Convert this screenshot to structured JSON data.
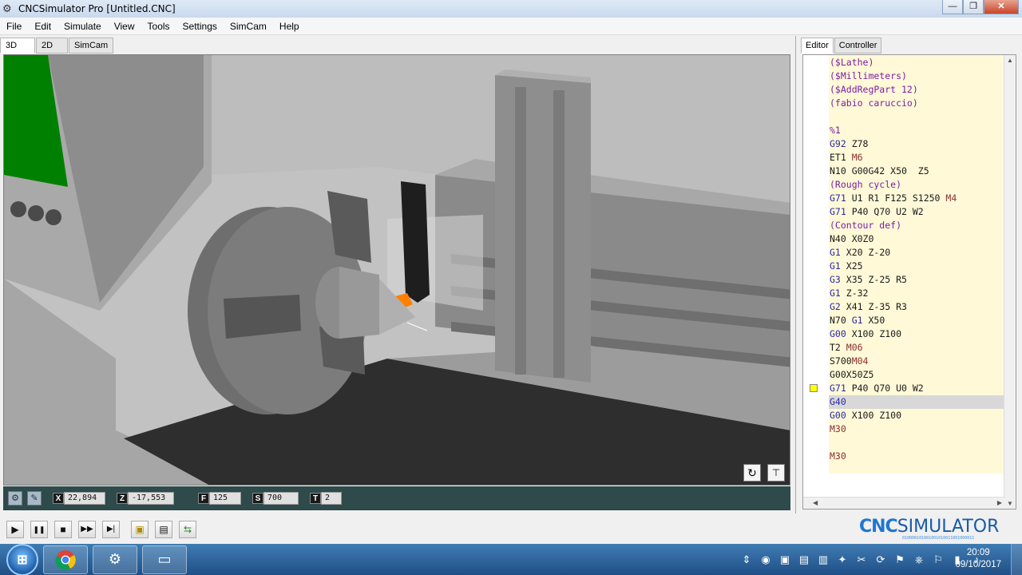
{
  "window": {
    "title": "CNCSimulator Pro [Untitled.CNC]",
    "min": "—",
    "max": "❐",
    "close": "✕"
  },
  "menu": [
    "File",
    "Edit",
    "Simulate",
    "View",
    "Tools",
    "Settings",
    "SimCam",
    "Help"
  ],
  "view_tabs": [
    "3D",
    "2D",
    "SimCam"
  ],
  "status": {
    "x_label": "X",
    "x_value": "22,894",
    "z_label": "Z",
    "z_value": "-17,553",
    "f_label": "F",
    "f_value": "125",
    "s_label": "S",
    "s_value": "700",
    "t_label": "T",
    "t_value": "2"
  },
  "editor_tabs": [
    "Editor",
    "Controller"
  ],
  "code_lines": [
    [
      {
        "t": "($Lathe)",
        "c": "purple"
      }
    ],
    [
      {
        "t": "($Millimeters)",
        "c": "purple"
      }
    ],
    [
      {
        "t": "($AddRegPart 12)",
        "c": "purple"
      }
    ],
    [
      {
        "t": "(fabio caruccio)",
        "c": "purple"
      }
    ],
    [
      {
        "t": "",
        "c": "black"
      }
    ],
    [
      {
        "t": "%1",
        "c": "purple"
      }
    ],
    [
      {
        "t": "G92",
        "c": "blue"
      },
      {
        "t": " Z78",
        "c": "black"
      }
    ],
    [
      {
        "t": "ET1",
        "c": "black"
      },
      {
        "t": " M6",
        "c": "brown"
      }
    ],
    [
      {
        "t": "N10 G00G42 X50  Z5",
        "c": "black"
      }
    ],
    [
      {
        "t": "(Rough cycle)",
        "c": "purple"
      }
    ],
    [
      {
        "t": "G71",
        "c": "blue"
      },
      {
        "t": " U1 R1 F125 S1250 ",
        "c": "black"
      },
      {
        "t": "M4",
        "c": "brown"
      }
    ],
    [
      {
        "t": "G71",
        "c": "blue"
      },
      {
        "t": " P40 Q70 U2 W2",
        "c": "black"
      }
    ],
    [
      {
        "t": "(Contour def)",
        "c": "purple"
      }
    ],
    [
      {
        "t": "N40 X0Z0",
        "c": "black"
      }
    ],
    [
      {
        "t": "G1",
        "c": "blue"
      },
      {
        "t": " X20 Z-20",
        "c": "black"
      }
    ],
    [
      {
        "t": "G1",
        "c": "blue"
      },
      {
        "t": " X25",
        "c": "black"
      }
    ],
    [
      {
        "t": "G3",
        "c": "blue"
      },
      {
        "t": " X35 Z-25 R5",
        "c": "black"
      }
    ],
    [
      {
        "t": "G1",
        "c": "blue"
      },
      {
        "t": " Z-32",
        "c": "black"
      }
    ],
    [
      {
        "t": "G2",
        "c": "blue"
      },
      {
        "t": " X41 Z-35 R3",
        "c": "black"
      }
    ],
    [
      {
        "t": "N70 ",
        "c": "black"
      },
      {
        "t": "G1",
        "c": "blue"
      },
      {
        "t": " X50",
        "c": "black"
      }
    ],
    [
      {
        "t": "G00",
        "c": "blue"
      },
      {
        "t": " X100 Z100",
        "c": "black"
      }
    ],
    [
      {
        "t": "T2 ",
        "c": "black"
      },
      {
        "t": "M06",
        "c": "brown"
      }
    ],
    [
      {
        "t": "S700",
        "c": "black"
      },
      {
        "t": "M04",
        "c": "brown"
      }
    ],
    [
      {
        "t": "G00X50Z5",
        "c": "black"
      }
    ],
    [
      {
        "t": "G71",
        "c": "blue"
      },
      {
        "t": " P40 Q70 U0 W2",
        "c": "black"
      }
    ],
    [
      {
        "t": "G40",
        "c": "blue"
      }
    ],
    [
      {
        "t": "G00",
        "c": "blue"
      },
      {
        "t": " X100 Z100",
        "c": "black"
      }
    ],
    [
      {
        "t": "M30",
        "c": "brown"
      }
    ],
    [
      {
        "t": "",
        "c": "black"
      }
    ],
    [
      {
        "t": "M30",
        "c": "brown"
      }
    ]
  ],
  "highlight_line": 25,
  "bookmark_line": 24,
  "toolbar": {
    "play": "▶",
    "pause": "❚❚",
    "stop": "■",
    "fast": "▶▶",
    "step": "▶|",
    "tool1": "▣",
    "tool2": "▤",
    "tool3": "⇆"
  },
  "logo": {
    "word1": "CNC",
    "word2": "SIMULATOR",
    "bits": "010000101001001010011001000011"
  },
  "taskbar": {
    "start": "⊞",
    "apps": [
      "chrome-icon",
      "gear-app-icon",
      "window-app-icon"
    ],
    "time": "20:09",
    "date": "09/10/2017"
  },
  "colors": {
    "editor_bg": "#fff9d8",
    "statusbar": "#2e4a4a",
    "bookmark": "#ffff00",
    "screen_green": "#008000",
    "tool_tip": "#ff8000"
  }
}
